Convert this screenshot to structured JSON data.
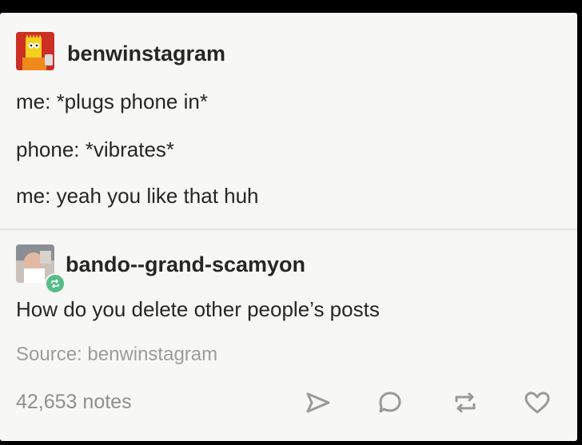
{
  "original_post": {
    "username": "benwinstagram",
    "lines": [
      "me: *plugs phone in*",
      "phone: *vibrates*",
      "me: yeah you like that huh"
    ]
  },
  "reblog": {
    "username": "bando--grand-scamyon",
    "text": "How do you delete other people’s posts"
  },
  "footer": {
    "source": "Source: benwinstagram",
    "notes": "42,653 notes"
  },
  "actions": {
    "icons": [
      "share-icon",
      "reply-icon",
      "reblog-icon",
      "like-icon"
    ]
  },
  "colors": {
    "reblog_badge": "#56bc8a",
    "avatar_background": "#cc2f24"
  }
}
